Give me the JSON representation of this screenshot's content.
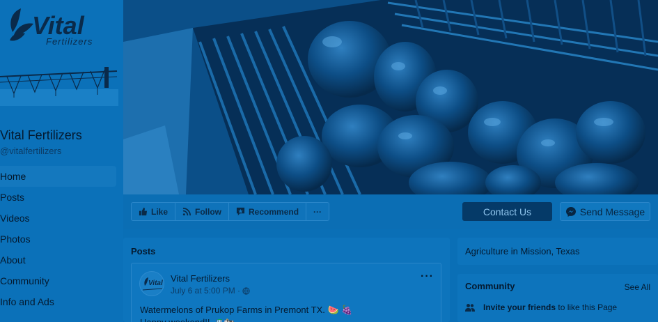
{
  "brand": {
    "logo_wordmark": "Vital",
    "logo_subtext": "Fertilizers",
    "page_name": "Vital Fertilizers",
    "handle": "@vitalfertilizers",
    "tint_color": "#0a6fb6"
  },
  "nav": {
    "items": [
      "Home",
      "Posts",
      "Videos",
      "Photos",
      "About",
      "Community",
      "Info and Ads"
    ],
    "active": "Home"
  },
  "actions": {
    "like": "Like",
    "follow": "Follow",
    "recommend": "Recommend",
    "more": "···",
    "contact": "Contact Us",
    "message": "Send Message"
  },
  "posts": {
    "title": "Posts",
    "items": [
      {
        "author": "Vital Fertilizers",
        "avatar_text": "Vital",
        "meta": "July 6 at 5:00 PM ·",
        "text_line1": "Watermelons of Prukop Farms in Premont TX. 🍉 🍇",
        "text_line2": "Happy weekend!! 🚜🐄"
      }
    ],
    "more": "···"
  },
  "sidebar_right": {
    "category": "Agriculture in Mission, Texas",
    "community_title": "Community",
    "see_all": "See All",
    "invite_bold": "Invite your friends",
    "invite_rest": "to like this Page"
  }
}
